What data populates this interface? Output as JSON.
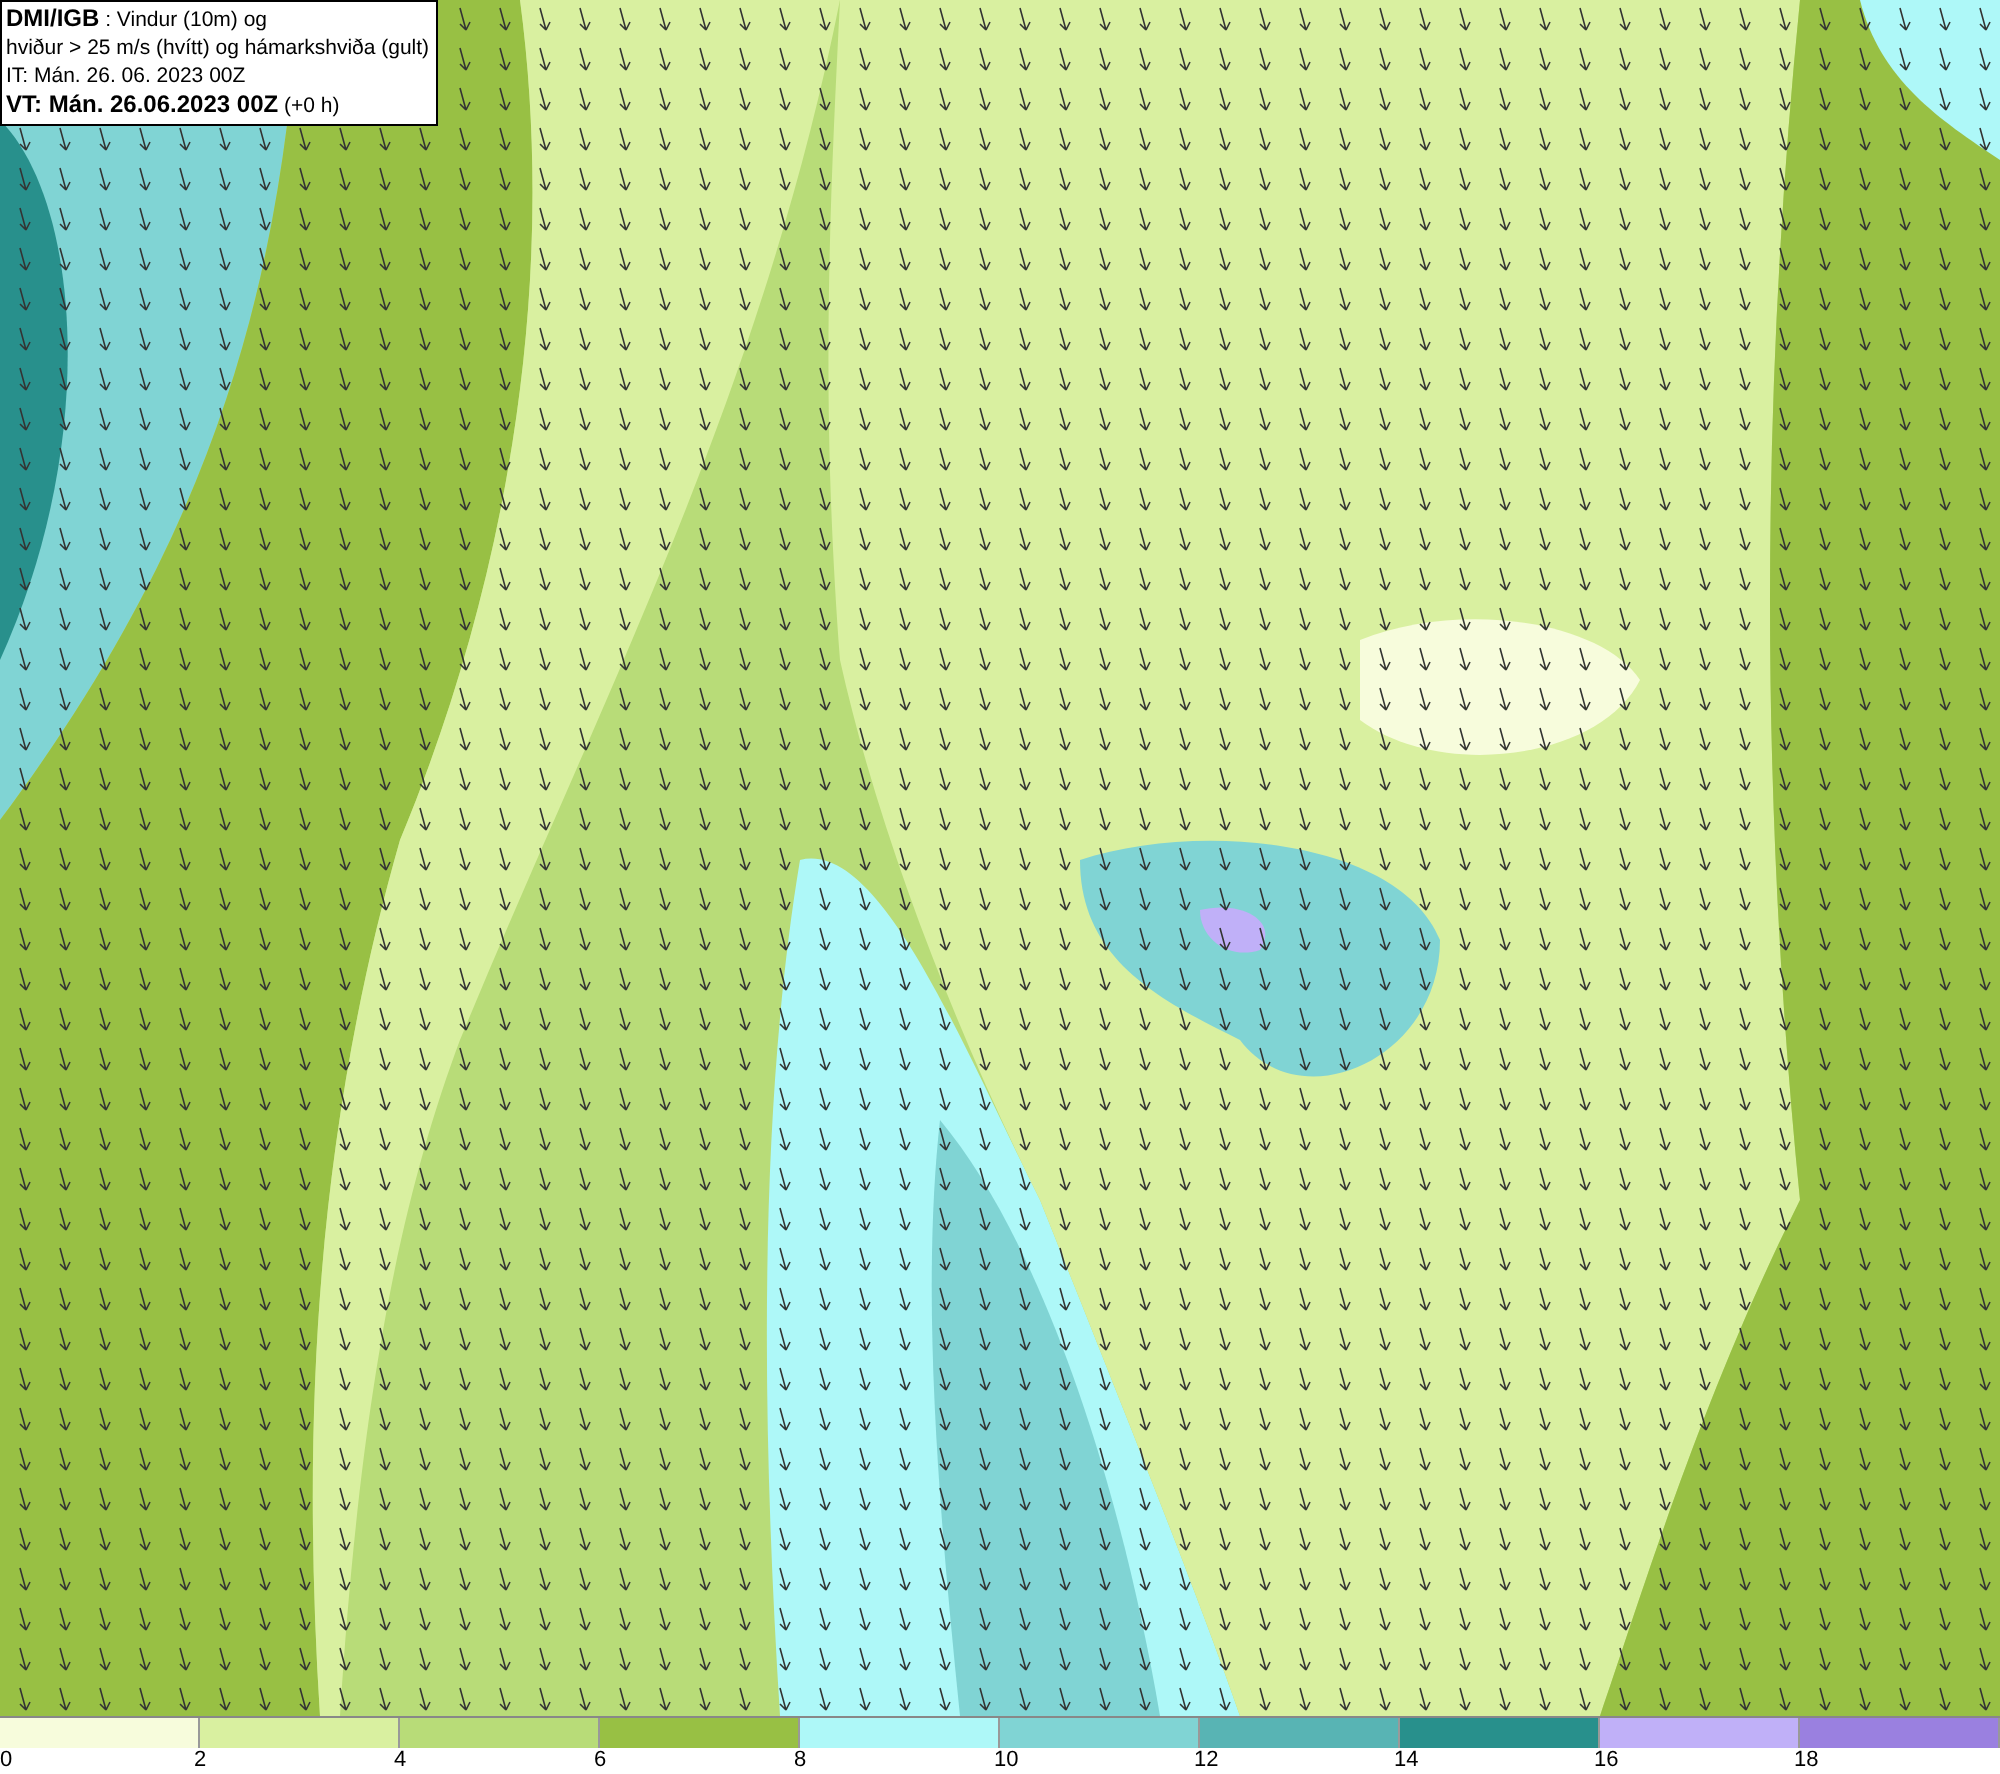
{
  "header": {
    "lines": [
      "**DMI/IGB** : Vindur (10m) og",
      "hviður > 25 m/s (hvítt) og hámarkshviða (gult)",
      "IT: Mán. 26. 06. 2023 00Z",
      "**VT: Mán. 26.06.2023 00Z** (+0 h)"
    ]
  },
  "legend": {
    "bins": [
      {
        "label": "0",
        "color": "#f7fcdc"
      },
      {
        "label": "2",
        "color": "#d9f0a0"
      },
      {
        "label": "4",
        "color": "#b8dc78"
      },
      {
        "label": "6",
        "color": "#98c044"
      },
      {
        "label": "8",
        "color": "#aef8f8"
      },
      {
        "label": "10",
        "color": "#80d4d4"
      },
      {
        "label": "12",
        "color": "#58b4b4"
      },
      {
        "label": "14",
        "color": "#28908c"
      },
      {
        "label": "16",
        "color": "#c0b0f8"
      },
      {
        "label": "18",
        "color": "#9a80e0"
      }
    ]
  }
}
